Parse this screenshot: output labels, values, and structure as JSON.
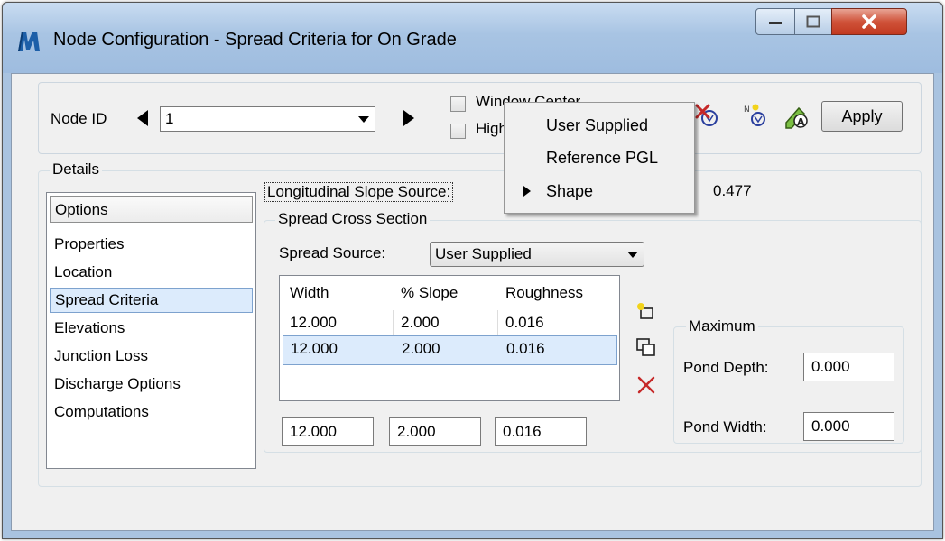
{
  "window": {
    "title": "Node Configuration - Spread Criteria for On Grade",
    "minimize_icon": "minimize-icon",
    "maximize_icon": "maximize-icon",
    "close_icon": "close-icon"
  },
  "toolbar": {
    "node_id_label": "Node ID",
    "node_id_value": "1",
    "window_center_label": "Window Center",
    "highlight_label": "High",
    "apply_label": "Apply",
    "icons": [
      "previous-arrow-icon",
      "next-arrow-icon",
      "delete-node-icon",
      "new-node-icon",
      "edit-node-icon"
    ]
  },
  "details": {
    "group_label": "Details",
    "options": {
      "header": "Options",
      "items": [
        "Properties",
        "Location",
        "Spread Criteria",
        "Elevations",
        "Junction Loss",
        "Discharge Options",
        "Computations"
      ],
      "selected": "Spread Criteria"
    },
    "longitudinal_slope_label": "Longitudinal Slope Source:",
    "longitudinal_slope_value": "0.477",
    "spread_cross_section": {
      "group_label": "Spread Cross Section",
      "spread_source_label": "Spread Source:",
      "spread_source_value": "User Supplied",
      "columns": [
        "Width",
        "% Slope",
        "Roughness"
      ],
      "rows": [
        [
          "12.000",
          "2.000",
          "0.016"
        ],
        [
          "12.000",
          "2.000",
          "0.016"
        ]
      ],
      "edit_width": "12.000",
      "edit_slope": "2.000",
      "edit_roughness": "0.016"
    },
    "maximum": {
      "group_label": "Maximum",
      "pond_depth_label": "Pond Depth:",
      "pond_depth_value": "0.000",
      "pond_width_label": "Pond Width:",
      "pond_width_value": "0.000"
    }
  },
  "popup_menu": {
    "items": [
      "User Supplied",
      "Reference PGL",
      "Shape"
    ],
    "checked": "Shape"
  }
}
